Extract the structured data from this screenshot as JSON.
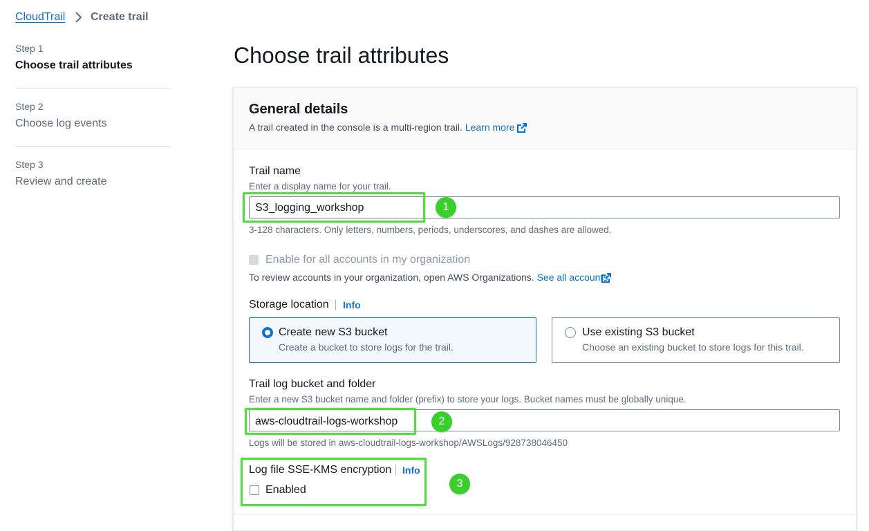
{
  "breadcrumb": {
    "root": "CloudTrail",
    "current": "Create trail"
  },
  "steps": [
    {
      "label": "Step 1",
      "title": "Choose trail attributes"
    },
    {
      "label": "Step 2",
      "title": "Choose log events"
    },
    {
      "label": "Step 3",
      "title": "Review and create"
    }
  ],
  "page_title": "Choose trail attributes",
  "general": {
    "title": "General details",
    "description": "A trail created in the console is a multi-region trail.",
    "learn_more": "Learn more"
  },
  "trail_name": {
    "label": "Trail name",
    "hint": "Enter a display name for your trail.",
    "value": "S3_logging_workshop",
    "constraint": "3-128 characters. Only letters, numbers, periods, underscores, and dashes are allowed."
  },
  "org": {
    "checkbox_label": "Enable for all accounts in my organization",
    "description": "To review accounts in your organization, open AWS Organizations.",
    "link": "See all accounts"
  },
  "storage": {
    "label": "Storage location",
    "info": "Info",
    "options": [
      {
        "title": "Create new S3 bucket",
        "desc": "Create a bucket to store logs for the trail.",
        "selected": true
      },
      {
        "title": "Use existing S3 bucket",
        "desc": "Choose an existing bucket to store logs for this trail.",
        "selected": false
      }
    ]
  },
  "bucket": {
    "label": "Trail log bucket and folder",
    "hint": "Enter a new S3 bucket name and folder (prefix) to store your logs. Bucket names must be globally unique.",
    "value": "aws-cloudtrail-logs-workshop",
    "stored_note": "Logs will be stored in aws-cloudtrail-logs-workshop/AWSLogs/928738046450"
  },
  "kms": {
    "label": "Log file SSE-KMS encryption",
    "info": "Info",
    "checkbox_label": "Enabled",
    "checked": false
  },
  "annotations": [
    "1",
    "2",
    "3"
  ],
  "colors": {
    "link": "#0972d3",
    "highlight": "#4fe03a",
    "badge": "#39d02c"
  }
}
